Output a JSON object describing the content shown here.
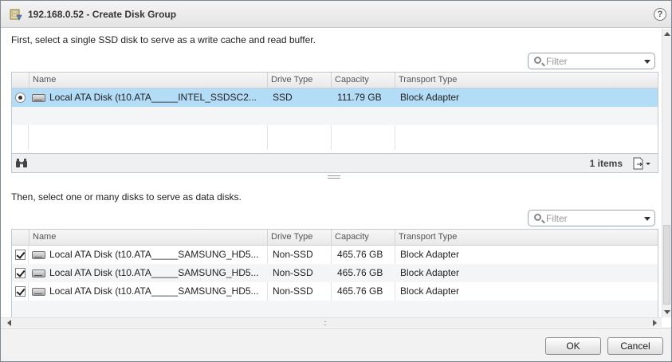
{
  "window": {
    "title": "192.168.0.52 - Create Disk Group",
    "help_label": "?"
  },
  "cache_section": {
    "instruction": "First, select a single SSD disk to serve as a write cache and read buffer.",
    "filter_placeholder": "Filter",
    "columns": [
      "Name",
      "Drive Type",
      "Capacity",
      "Transport Type"
    ],
    "rows": [
      {
        "selected": true,
        "name": "Local ATA Disk (t10.ATA_____INTEL_SSDSC2...",
        "drive_type": "SSD",
        "capacity": "111.79 GB",
        "transport": "Block Adapter"
      }
    ],
    "item_count": "1 items"
  },
  "data_section": {
    "instruction": "Then, select one or many disks to serve as data disks.",
    "filter_placeholder": "Filter",
    "columns": [
      "Name",
      "Drive Type",
      "Capacity",
      "Transport Type"
    ],
    "rows": [
      {
        "checked": true,
        "name": "Local ATA Disk (t10.ATA_____SAMSUNG_HD5...",
        "drive_type": "Non-SSD",
        "capacity": "465.76 GB",
        "transport": "Block Adapter"
      },
      {
        "checked": true,
        "name": "Local ATA Disk (t10.ATA_____SAMSUNG_HD5...",
        "drive_type": "Non-SSD",
        "capacity": "465.76 GB",
        "transport": "Block Adapter"
      },
      {
        "checked": true,
        "name": "Local ATA Disk (t10.ATA_____SAMSUNG_HD5...",
        "drive_type": "Non-SSD",
        "capacity": "465.76 GB",
        "transport": "Block Adapter"
      }
    ]
  },
  "buttons": {
    "ok": "OK",
    "cancel": "Cancel"
  },
  "colors": {
    "selected_row": "#b3dcf7",
    "dialog_border": "#7d8893"
  }
}
